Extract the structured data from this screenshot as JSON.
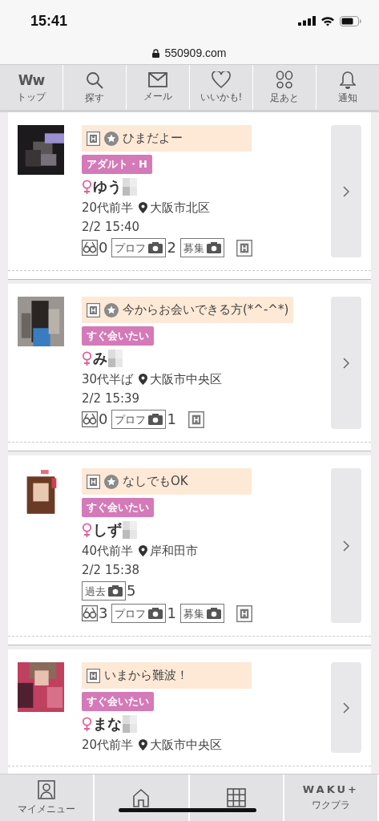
{
  "status_bar": {
    "time": "15:41"
  },
  "address_bar": {
    "url": "550909.com"
  },
  "top_nav": [
    {
      "kind": "logo",
      "logo": "Ww",
      "label": "トップ"
    },
    {
      "kind": "search",
      "label": "探す"
    },
    {
      "kind": "mail",
      "label": "メール"
    },
    {
      "kind": "heart",
      "label": "いいかも!"
    },
    {
      "kind": "footprints",
      "label": "足あと"
    },
    {
      "kind": "bell",
      "label": "通知"
    }
  ],
  "posts": [
    {
      "h_mark": true,
      "star_mark": true,
      "title": "ひまだよー",
      "tag": "アダルト・H",
      "name": "ゆう",
      "age": "20代前半",
      "location": "大阪市北区",
      "time": "2/2 15:40",
      "stat_rows": [
        [
          {
            "kind": "views",
            "count": "0"
          },
          {
            "label": "プロフ",
            "count": "2"
          },
          {
            "label": "募集"
          },
          {
            "kind": "h"
          }
        ]
      ]
    },
    {
      "h_mark": true,
      "star_mark": true,
      "title": "今からお会いできる方(*^-^*)",
      "tag": "すぐ会いたい",
      "name": "み",
      "age": "30代半ば",
      "location": "大阪市中央区",
      "time": "2/2 15:39",
      "stat_rows": [
        [
          {
            "kind": "views",
            "count": "0"
          },
          {
            "label": "プロフ",
            "count": "1"
          },
          {
            "kind": "h"
          }
        ]
      ]
    },
    {
      "h_mark": true,
      "star_mark": true,
      "title": "なしでもOK",
      "tag": "すぐ会いたい",
      "name": "しず",
      "age": "40代前半",
      "location": "岸和田市",
      "time": "2/2 15:38",
      "stat_rows": [
        [
          {
            "label": "過去",
            "count": "5"
          }
        ],
        [
          {
            "kind": "views",
            "count": "3"
          },
          {
            "label": "プロフ",
            "count": "1"
          },
          {
            "label": "募集"
          },
          {
            "kind": "h"
          }
        ]
      ]
    },
    {
      "h_mark": true,
      "star_mark": false,
      "title": "いまから難波！",
      "tag": "すぐ会いたい",
      "name": "まな",
      "age": "20代前半",
      "location": "大阪市中央区"
    }
  ],
  "bottom_nav": [
    {
      "kind": "person",
      "label": "マイメニュー"
    },
    {
      "kind": "home"
    },
    {
      "kind": "grid"
    },
    {
      "kind": "logo",
      "logo": "WAKU+",
      "label": "ワクプラ"
    }
  ]
}
